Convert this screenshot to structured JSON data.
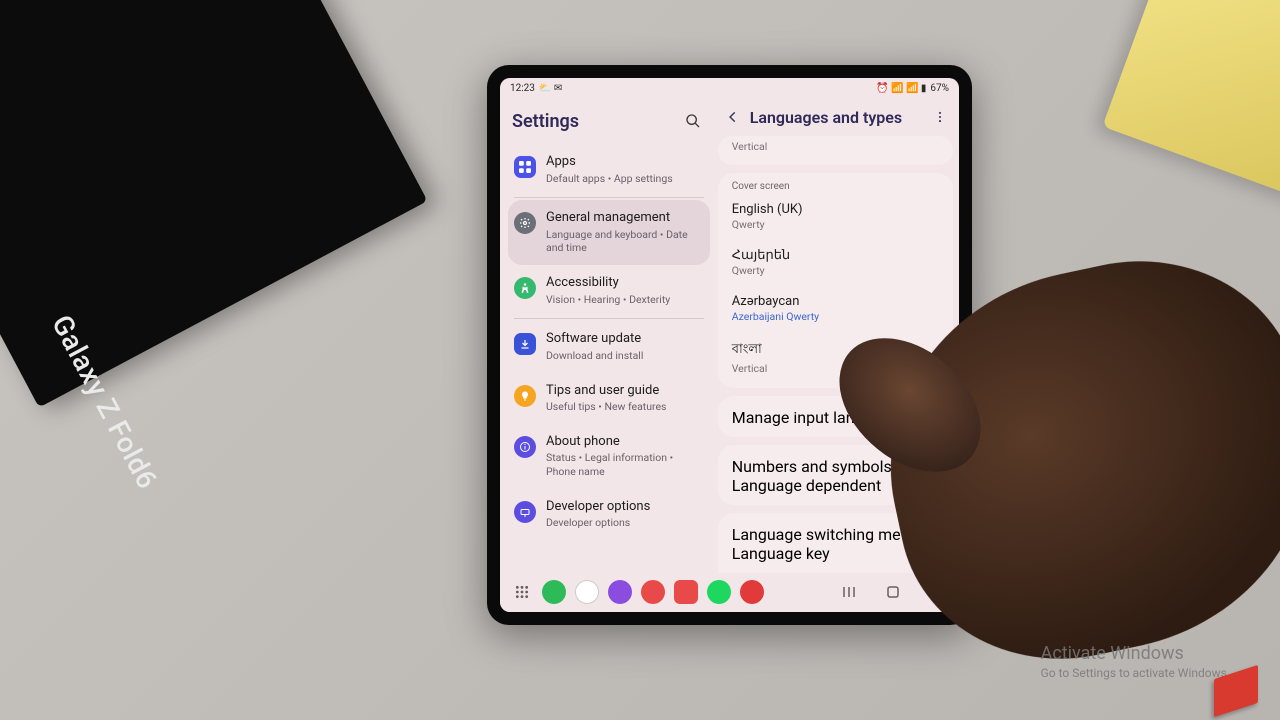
{
  "statusbar": {
    "time": "12:23",
    "icons_left": "⛅ ✉",
    "battery": "67%",
    "icons_right": "⏰ 📶 📶 ▮"
  },
  "left": {
    "title": "Settings",
    "items": [
      {
        "title": "Apps",
        "sub": "Default apps  •  App settings"
      },
      {
        "title": "General management",
        "sub": "Language and keyboard  •  Date and time"
      },
      {
        "title": "Accessibility",
        "sub": "Vision  •  Hearing  •  Dexterity"
      },
      {
        "title": "Software update",
        "sub": "Download and install"
      },
      {
        "title": "Tips and user guide",
        "sub": "Useful tips  •  New features"
      },
      {
        "title": "About phone",
        "sub": "Status  •  Legal information  •  Phone name"
      },
      {
        "title": "Developer options",
        "sub": "Developer options"
      }
    ]
  },
  "right": {
    "title": "Languages and types",
    "partial_top_sub": "Vertical",
    "cover_caption": "Cover screen",
    "languages": [
      {
        "title": "English (UK)",
        "sub": "Qwerty",
        "blue": false
      },
      {
        "title": "Հայերեն",
        "sub": "Qwerty",
        "blue": false
      },
      {
        "title": "Azərbaycan",
        "sub": "Azerbaijani Qwerty",
        "blue": true
      },
      {
        "title": "বাংলা",
        "sub": "Vertical",
        "blue": false
      }
    ],
    "manage": "Manage input languages",
    "numbers": {
      "title": "Numbers and symbols",
      "sub": "Language dependent"
    },
    "switching": {
      "title": "Language switching method",
      "sub": "Language key"
    }
  },
  "activate": {
    "line1": "Activate Windows",
    "line2": "Go to Settings to activate Windows."
  },
  "box_label": "Galaxy Z Fold6"
}
